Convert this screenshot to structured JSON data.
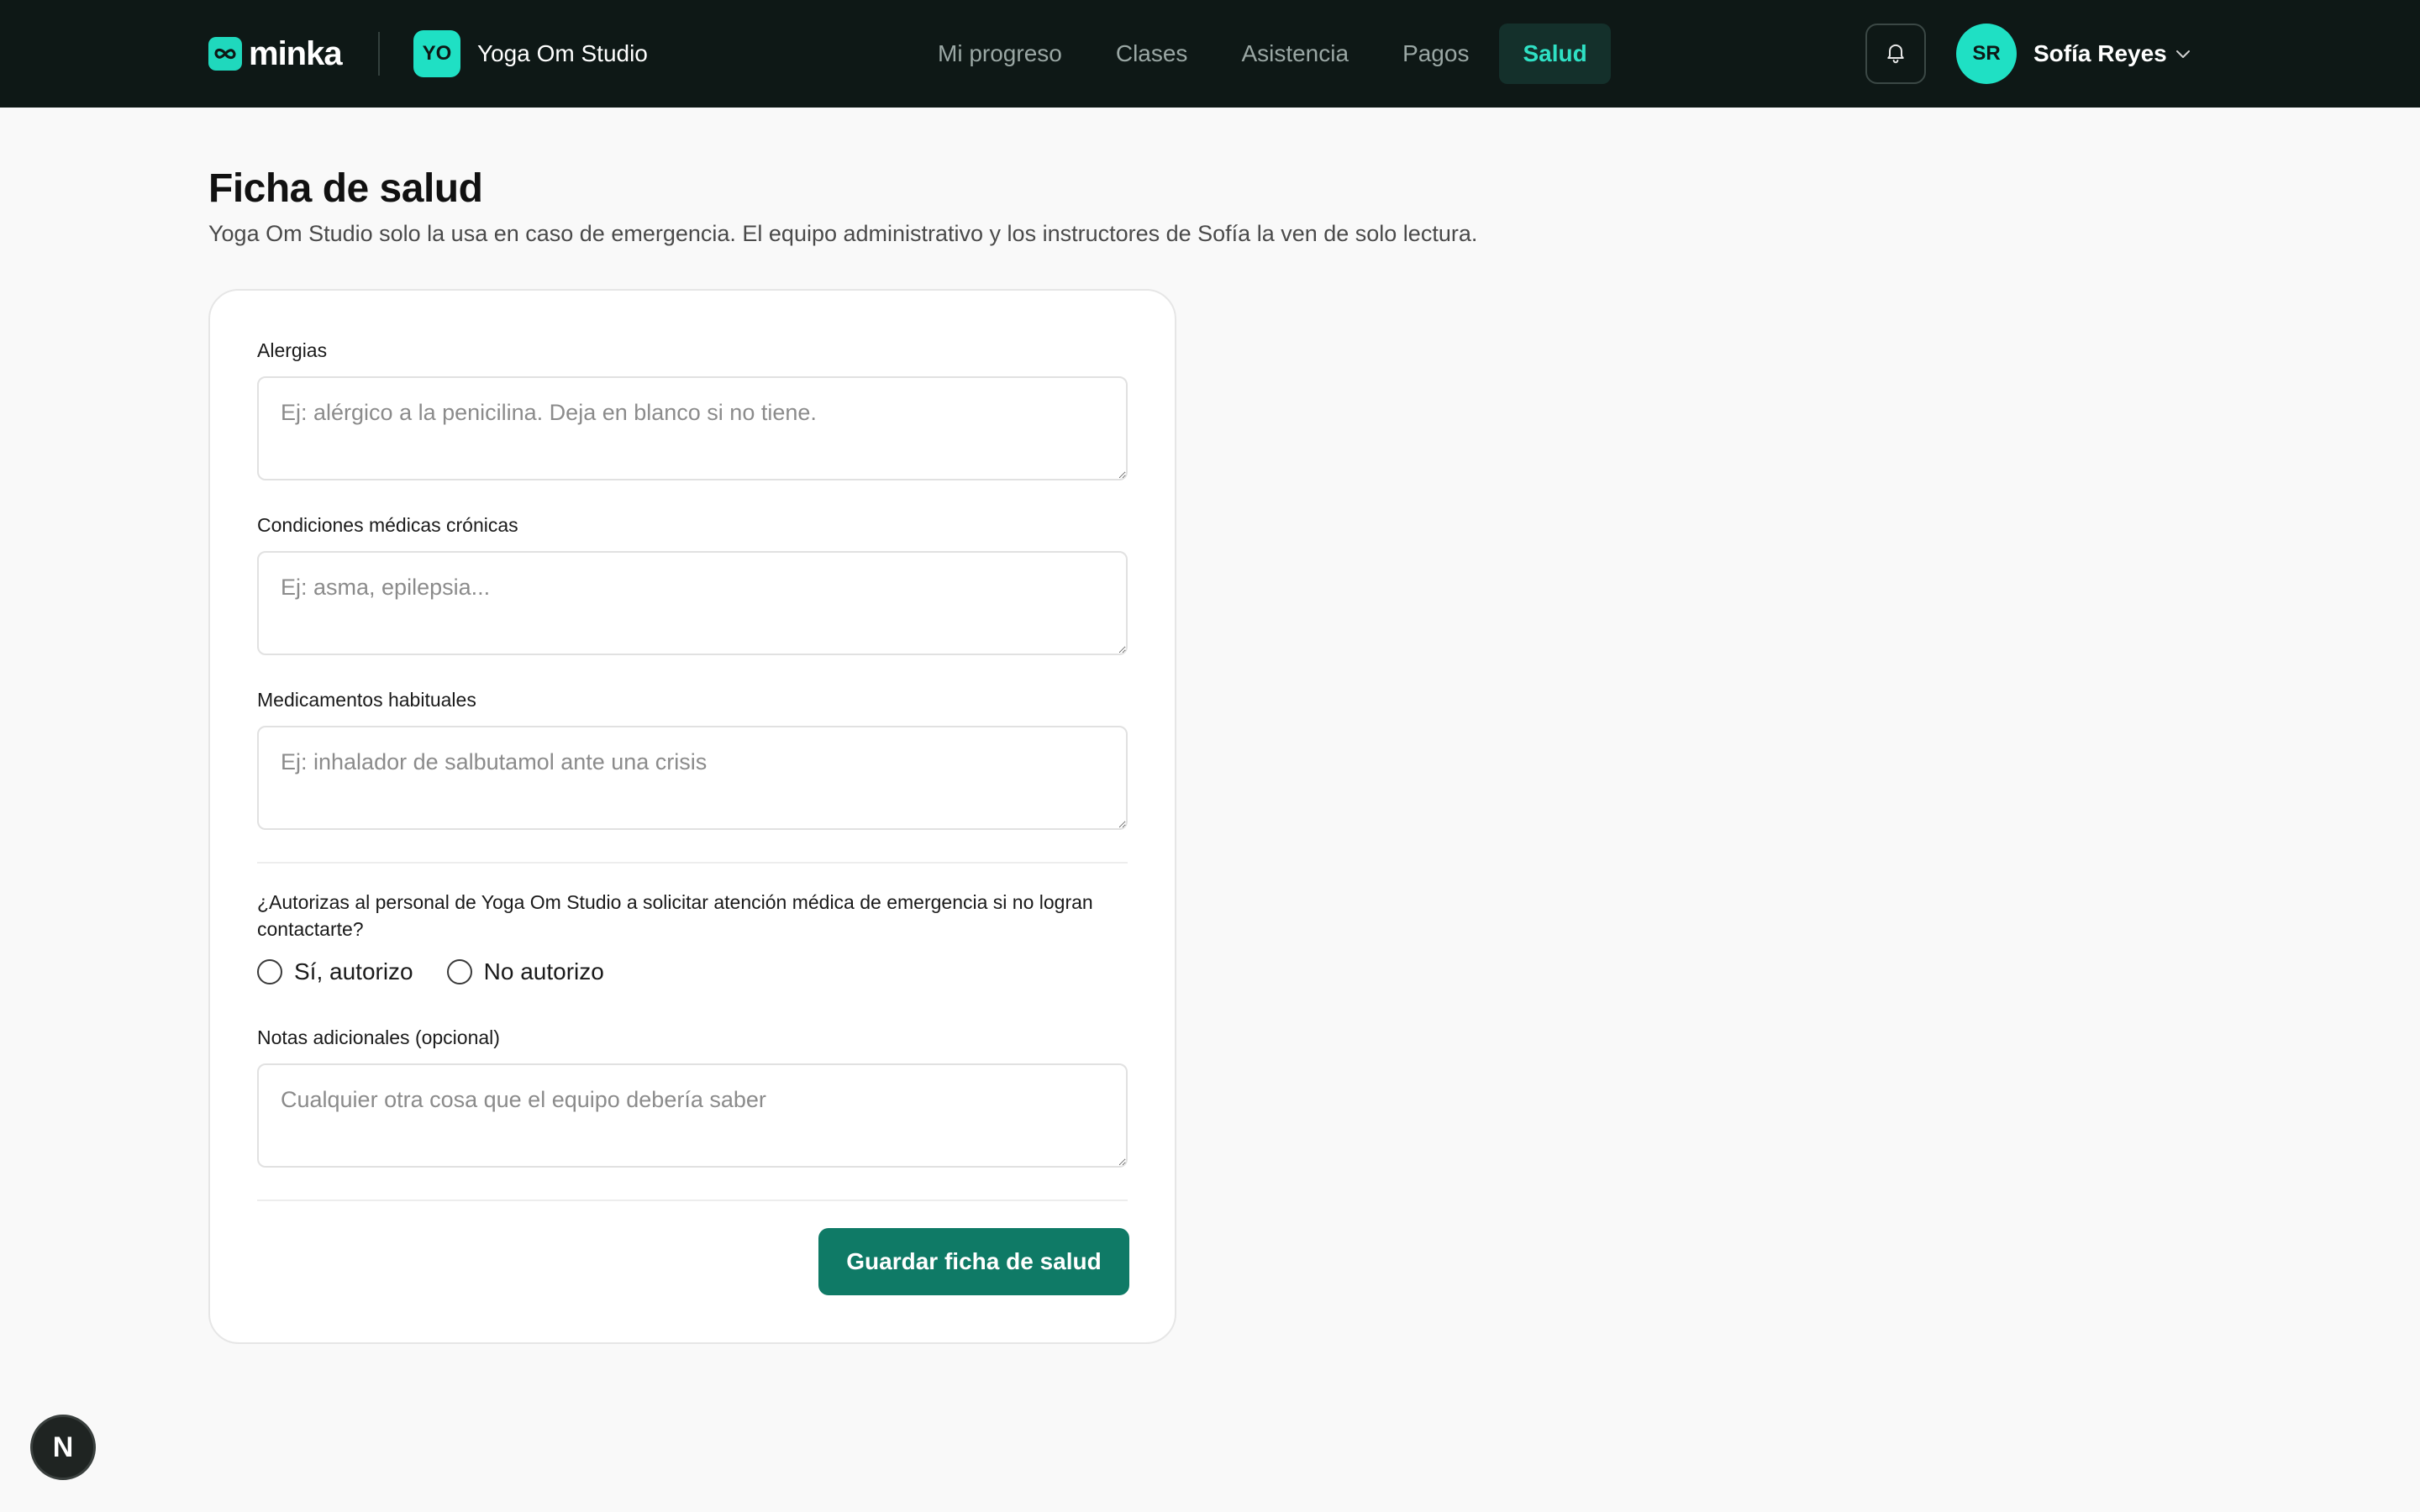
{
  "header": {
    "logo_text": "minka",
    "studio_initials": "YO",
    "studio_name": "Yoga Om Studio",
    "nav": [
      {
        "label": "Mi progreso",
        "active": false
      },
      {
        "label": "Clases",
        "active": false
      },
      {
        "label": "Asistencia",
        "active": false
      },
      {
        "label": "Pagos",
        "active": false
      },
      {
        "label": "Salud",
        "active": true
      }
    ],
    "user": {
      "initials": "SR",
      "name": "Sofía Reyes"
    }
  },
  "page": {
    "title": "Ficha de salud",
    "subtitle": "Yoga Om Studio solo la usa en caso de emergencia. El equipo administrativo y los instructores de Sofía la ven de solo lectura."
  },
  "form": {
    "allergies": {
      "label": "Alergias",
      "value": "",
      "placeholder": "Ej: alérgico a la penicilina. Deja en blanco si no tiene."
    },
    "conditions": {
      "label": "Condiciones médicas crónicas",
      "value": "",
      "placeholder": "Ej: asma, epilepsia..."
    },
    "medications": {
      "label": "Medicamentos habituales",
      "value": "",
      "placeholder": "Ej: inhalador de salbutamol ante una crisis"
    },
    "authorization": {
      "question": "¿Autorizas al personal de Yoga Om Studio a solicitar atención médica de emergencia si no logran contactarte?",
      "options": [
        "Sí, autorizo",
        "No autorizo"
      ],
      "selected": null
    },
    "notes": {
      "label": "Notas adicionales (opcional)",
      "value": "",
      "placeholder": "Cualquier otra cosa que el equipo debería saber"
    },
    "submit_label": "Guardar ficha de salud"
  },
  "dev_badge": {
    "letter": "N"
  },
  "colors": {
    "topbar": "#0e1816",
    "accent": "#1fe0c4",
    "primary_button": "#0f7a66",
    "page_background": "#f9f9f9"
  },
  "icons": {
    "logo": "infinity-icon",
    "notifications": "bell-icon",
    "user_menu": "chevron-down-icon"
  }
}
